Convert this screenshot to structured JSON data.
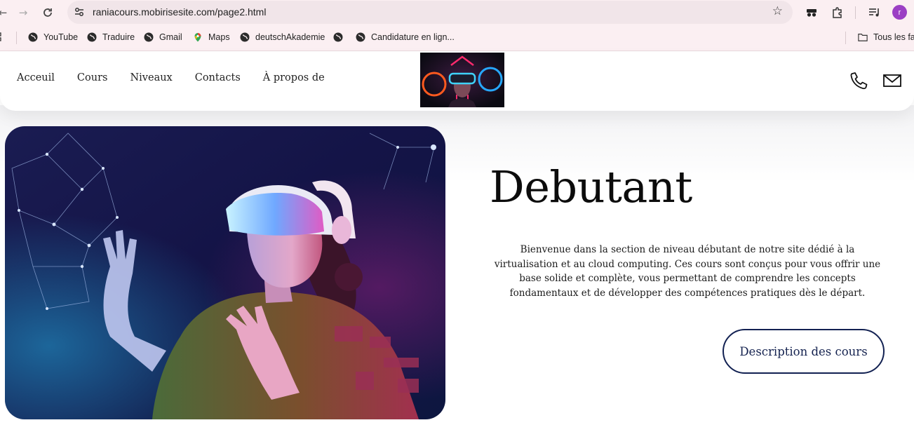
{
  "browser": {
    "url": "raniacours.mobirisesite.com/page2.html",
    "bookmarks": [
      {
        "label": "YouTube"
      },
      {
        "label": "Traduire"
      },
      {
        "label": "Gmail"
      },
      {
        "label": "Maps"
      },
      {
        "label": "deutschAkademie"
      },
      {
        "label": ""
      },
      {
        "label": "Candidature en lign..."
      }
    ],
    "all_bookmarks": "Tous les fa",
    "profile_initial": "r"
  },
  "header": {
    "menu": [
      {
        "label": "Acceuil"
      },
      {
        "label": "Cours"
      },
      {
        "label": "Niveaux"
      },
      {
        "label": "Contacts"
      },
      {
        "label": "À propos de"
      }
    ]
  },
  "hero": {
    "title": "Debutant",
    "description": "Bienvenue dans la section de niveau débutant de notre site dédié à la virtualisation et au cloud computing. Ces cours sont conçus pour vous offrir une base solide et complète, vous permettant de comprendre les concepts fondamentaux et de développer des compétences pratiques dès le départ.",
    "button_label": "Description des cours"
  },
  "colors": {
    "accent": "#122152",
    "chrome": "#fbeff2",
    "avatar": "#9b3fc4"
  }
}
